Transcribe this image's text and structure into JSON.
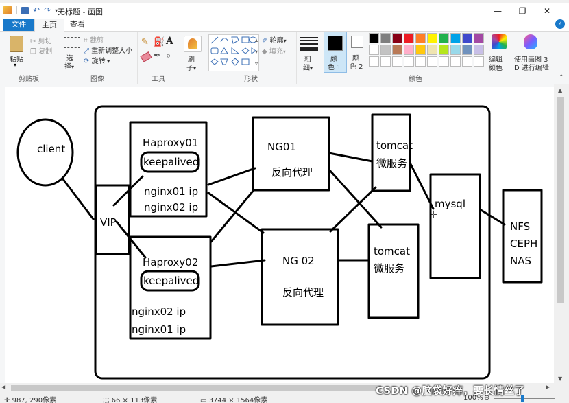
{
  "window": {
    "title": "无标题 - 画图",
    "controls": {
      "minimize": "—",
      "restore": "❐",
      "close": "✕"
    }
  },
  "tabs": [
    {
      "label": "文件"
    },
    {
      "label": "主页"
    },
    {
      "label": "查看"
    }
  ],
  "ribbon": {
    "clipboard": {
      "paste": "粘贴",
      "cut": "剪切",
      "copy": "复制",
      "group": "剪贴板"
    },
    "image": {
      "select": "选",
      "select2": "择",
      "crop": "裁剪",
      "resize": "重新调整大小",
      "rotate": "旋转",
      "group": "图像"
    },
    "tools": {
      "group": "工具"
    },
    "brushes": {
      "label1": "刷",
      "label2": "子"
    },
    "shapes": {
      "outline": "轮廓",
      "fill": "填充",
      "group": "形状"
    },
    "size": {
      "label1": "粗",
      "label2": "细"
    },
    "color1": {
      "label1": "颜",
      "label2": "色 1"
    },
    "color2": {
      "label1": "颜",
      "label2": "色 2"
    },
    "colors": {
      "group": "颜色"
    },
    "edit_colors": {
      "label1": "编辑",
      "label2": "颜色"
    },
    "paint3d": {
      "label1": "使用画图 3",
      "label2": "D 进行编辑"
    },
    "palette": [
      "#000000",
      "#7f7f7f",
      "#880015",
      "#ed1c24",
      "#ff7f27",
      "#fff200",
      "#22b14c",
      "#00a2e8",
      "#3f48cc",
      "#a349a4",
      "#ffffff",
      "#c3c3c3",
      "#b97a57",
      "#ffaec9",
      "#ffc90e",
      "#efe4b0",
      "#b5e61d",
      "#99d9ea",
      "#7092be",
      "#c8bfe7",
      "#ffffff",
      "#ffffff",
      "#ffffff",
      "#ffffff",
      "#ffffff",
      "#ffffff",
      "#ffffff",
      "#ffffff",
      "#ffffff",
      "#ffffff"
    ]
  },
  "diagram": {
    "client": "client",
    "vip": "VIP",
    "haproxy01": "Haproxy01",
    "haproxy01_keepalived": "keepalived",
    "haproxy01_ip1": "nginx01 ip",
    "haproxy01_ip2": "nginx02 ip",
    "haproxy02": "Haproxy02",
    "haproxy02_keepalived": "keepalived",
    "haproxy02_ip1": "nginx02 ip",
    "haproxy02_ip2": "nginx01 ip",
    "ng01": "NG01",
    "ng01_desc": "反向代理",
    "ng02": "NG 02",
    "ng02_desc": "反向代理",
    "tomcat1": "tomcat",
    "tomcat1_desc": "微服务",
    "tomcat2": "tomcat",
    "tomcat2_desc": "微服务",
    "mysql": "mysql",
    "nfs": "NFS",
    "ceph": "CEPH",
    "nas": "NAS"
  },
  "status": {
    "cursor_pos": "987, 290像素",
    "selection_size": "66 × 113像素",
    "image_size": "3744 × 1564像素",
    "zoom": "100%",
    "watermark": "CSDN @脑袋好痒，要长情丝了"
  }
}
